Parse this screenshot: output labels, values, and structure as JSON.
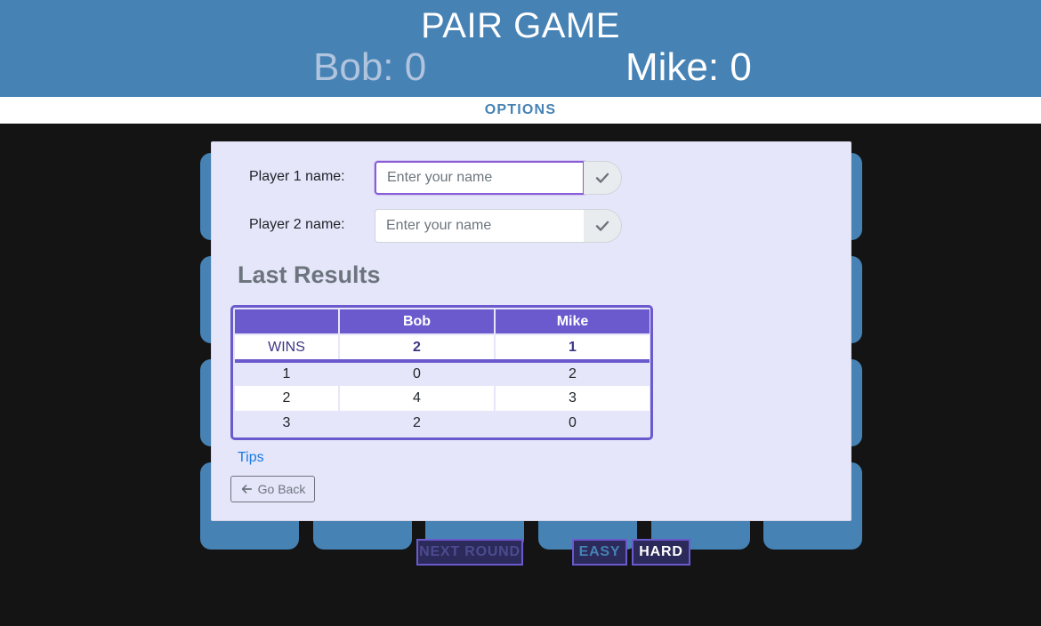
{
  "header": {
    "title": "PAIR GAME",
    "player1": {
      "name": "Bob",
      "score": "0"
    },
    "player2": {
      "name": "Mike",
      "score": "0"
    },
    "separator": ": "
  },
  "nav": {
    "options_label": "OPTIONS"
  },
  "modal": {
    "player1_label": "Player 1 name:",
    "player2_label": "Player 2 name:",
    "input_placeholder": "Enter your name",
    "player1_value": "",
    "player2_value": "",
    "confirm_icon": "check-icon",
    "results_title": "Last Results",
    "table": {
      "headers": [
        "",
        "Bob",
        "Mike"
      ],
      "wins": {
        "label": "WINS",
        "values": [
          "2",
          "1"
        ]
      },
      "rounds": [
        [
          "1",
          "0",
          "2"
        ],
        [
          "2",
          "4",
          "3"
        ],
        [
          "3",
          "2",
          "0"
        ]
      ]
    },
    "tips_label": "Tips",
    "back_label": "Go Back",
    "back_icon": "arrow-left-icon"
  },
  "controls": {
    "next_round": "NEXT ROUND",
    "easy": "EASY",
    "hard": "HARD"
  },
  "colors": {
    "header_bg": "#4682b4",
    "accent": "#6a5acd",
    "modal_bg": "#e6e6fa",
    "page_bg": "#141414"
  }
}
